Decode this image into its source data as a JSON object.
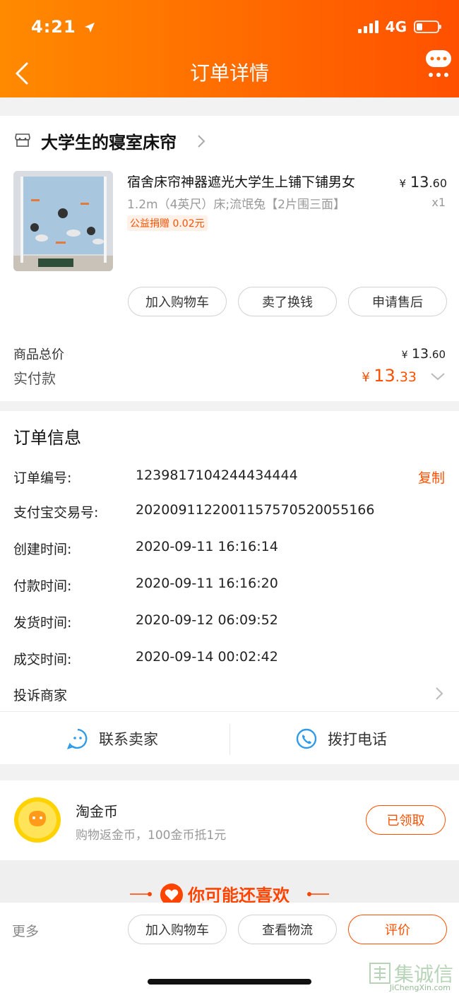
{
  "status": {
    "time": "4:21",
    "network": "4G"
  },
  "nav": {
    "title": "订单详情"
  },
  "shop": {
    "name": "大学生的寝室床帘"
  },
  "product": {
    "title": "宿舍床帘神器遮光大学生上铺下铺男女",
    "spec": "1.2m（4英尺）床;流氓兔【2片围三面】",
    "charity": "公益捐赠 0.02元",
    "price_int": "13",
    "price_dec": ".60",
    "currency": "¥",
    "qty": "x1"
  },
  "item_actions": [
    "加入购物车",
    "卖了换钱",
    "申请售后"
  ],
  "totals": {
    "goods_label": "商品总价",
    "goods_int": "13",
    "goods_dec": ".60",
    "paid_label": "实付款",
    "paid_int": "13",
    "paid_dec": ".33"
  },
  "order_info": {
    "title": "订单信息",
    "copy_label": "复制",
    "rows": [
      {
        "label": "订单编号:",
        "value": "1239817104244434444"
      },
      {
        "label": "支付宝交易号:",
        "value": "2020091122001157570520055166"
      },
      {
        "label": "创建时间:",
        "value": "2020-09-11 16:16:14"
      },
      {
        "label": "付款时间:",
        "value": "2020-09-11 16:16:20"
      },
      {
        "label": "发货时间:",
        "value": "2020-09-12 06:09:52"
      },
      {
        "label": "成交时间:",
        "value": "2020-09-14 00:02:42"
      }
    ],
    "complaint": "投诉商家"
  },
  "contact": {
    "seller": "联系卖家",
    "phone": "拨打电话"
  },
  "coins": {
    "title": "淘金币",
    "desc": "购物返金币，100金币抵1元",
    "button": "已领取"
  },
  "recommend": {
    "title": "你可能还喜欢"
  },
  "bottom": {
    "more": "更多",
    "buttons": [
      "加入购物车",
      "查看物流",
      "评价"
    ]
  },
  "watermark": {
    "cn": "集诚信",
    "en": "JiChengXin.com"
  },
  "colors": {
    "accent": "#ff5000",
    "header_start": "#ff8a00",
    "header_end": "#ff5000",
    "link_blue": "#2f9be8"
  }
}
